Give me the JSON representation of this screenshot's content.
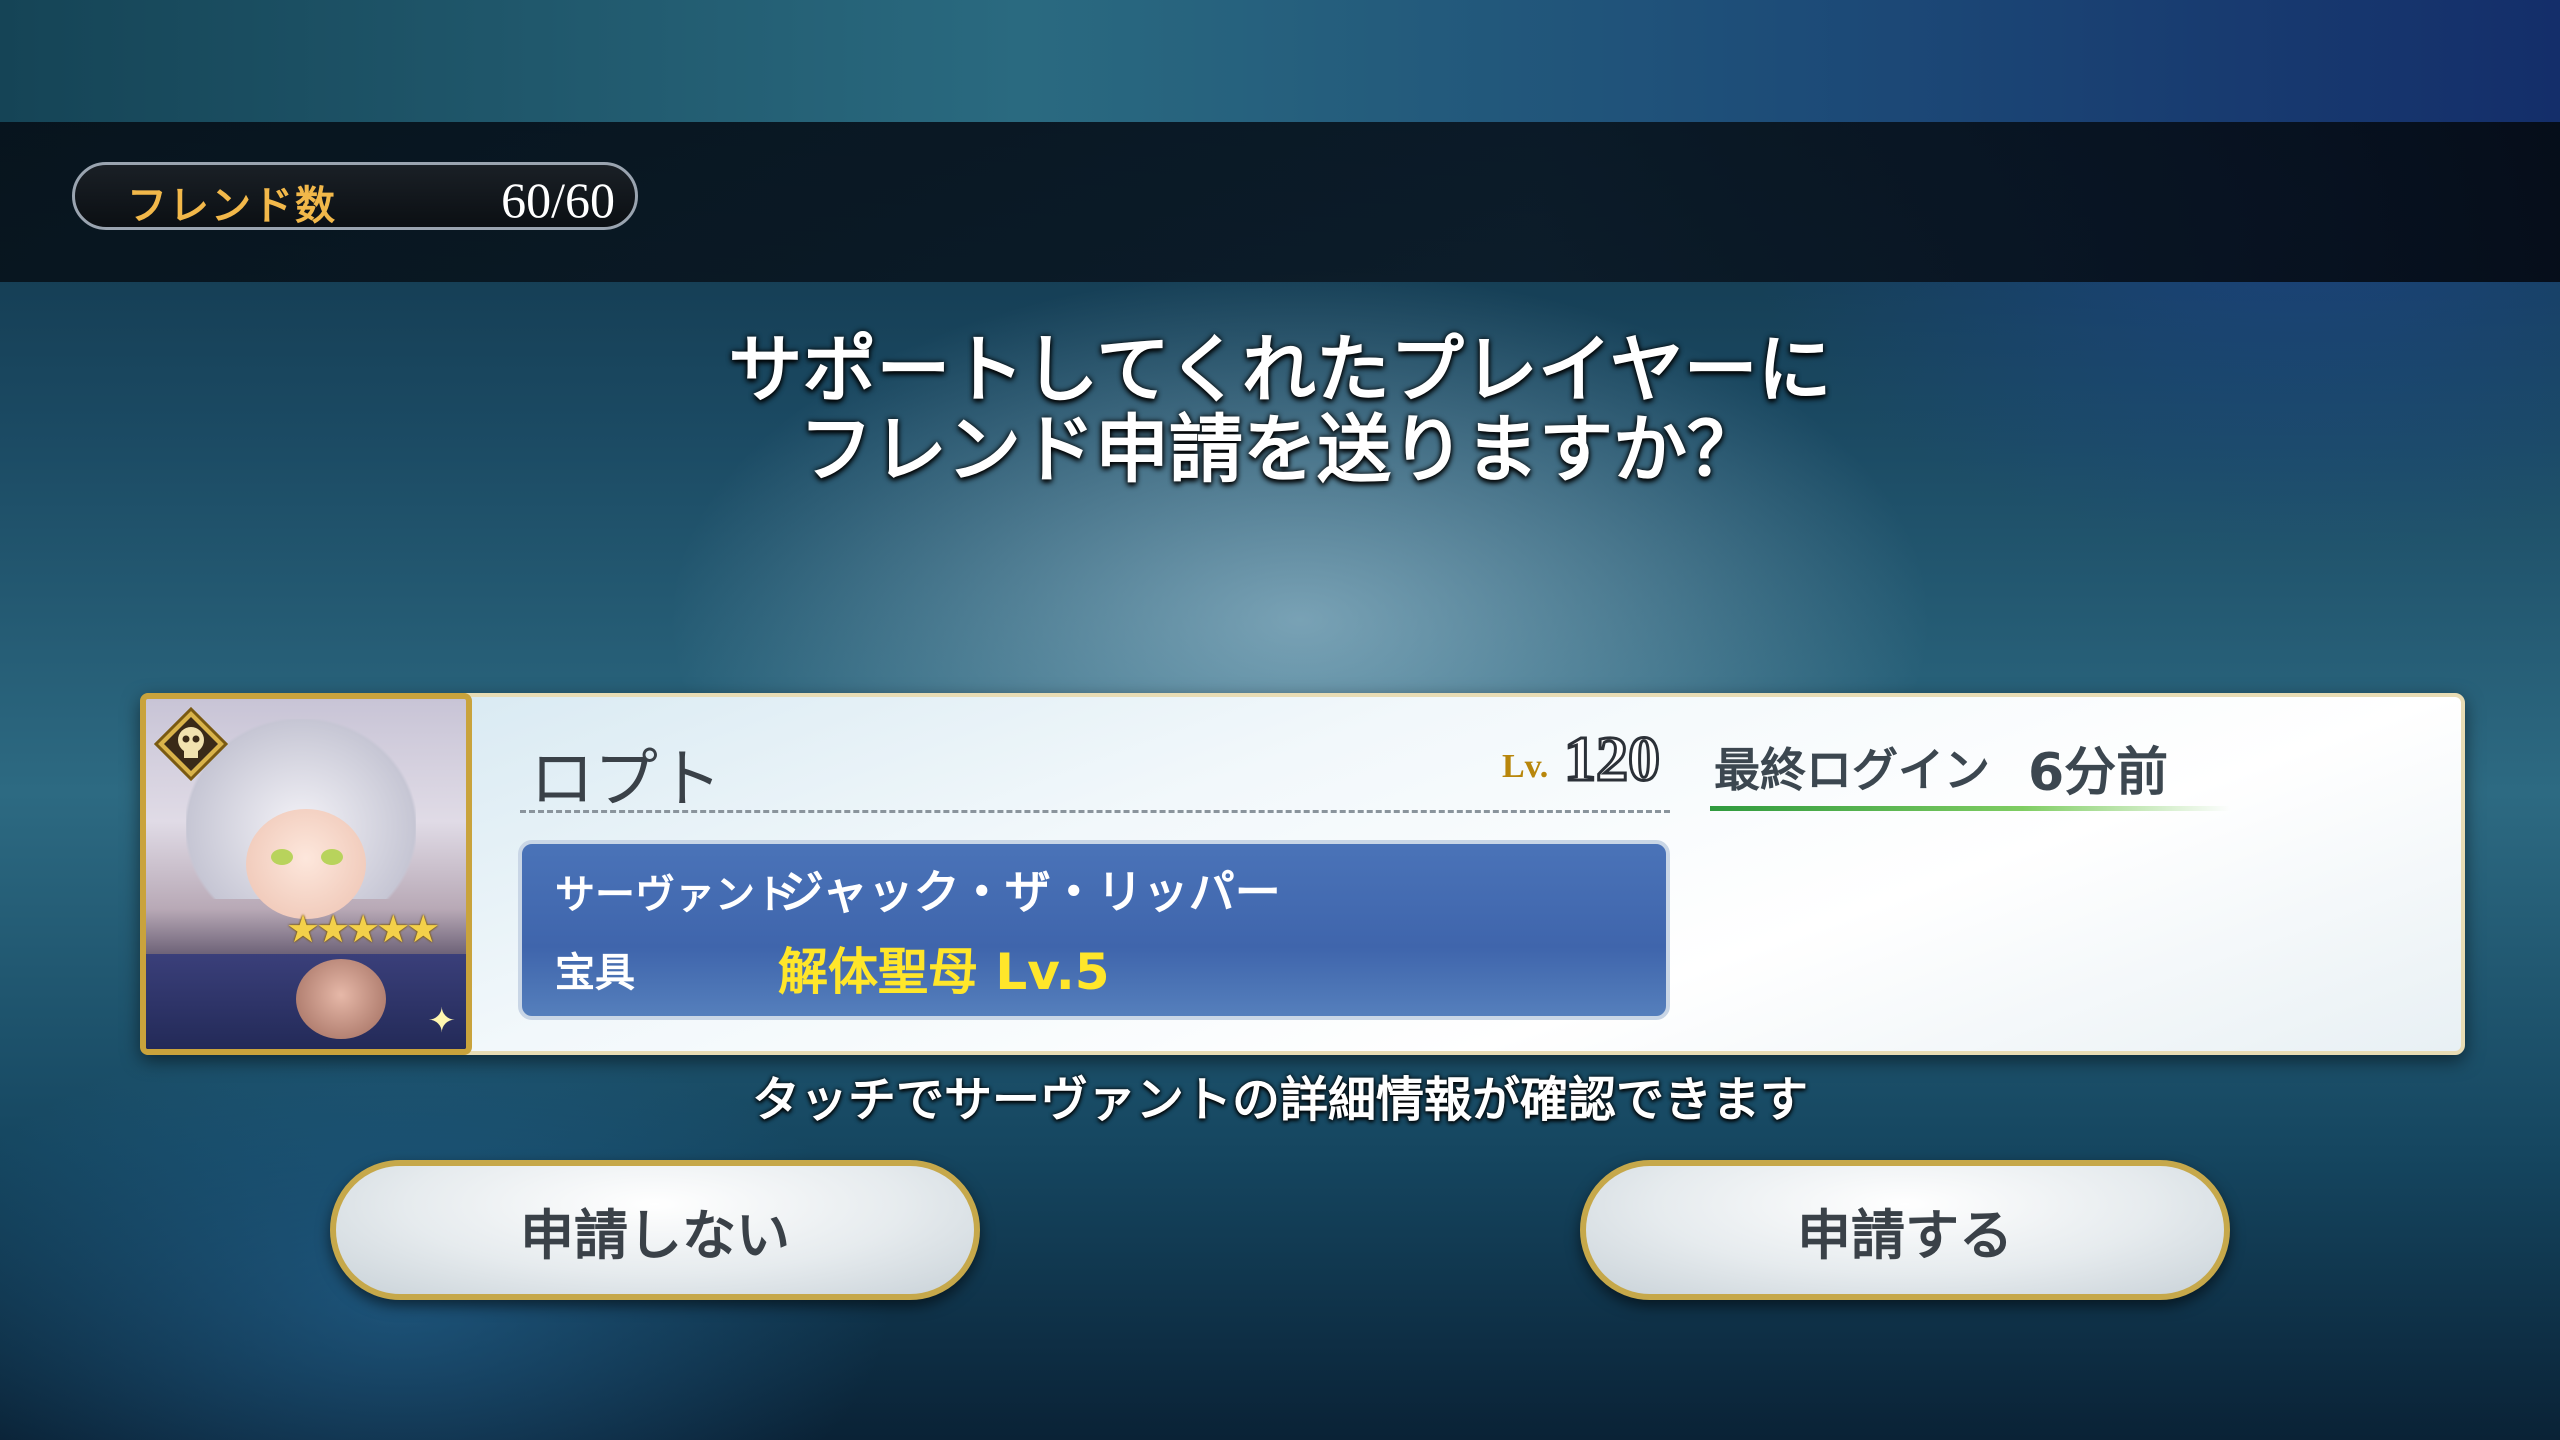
{
  "friends": {
    "label": "フレンド数",
    "count": "60/60"
  },
  "question": {
    "line1": "サポートしてくれたプレイヤーに",
    "line2": "フレンド申請を送りますか？"
  },
  "player": {
    "name": "ロプト",
    "level_tag": "Lv.",
    "level": "120",
    "last_login_label": "最終ログイン",
    "last_login_value": "6分前"
  },
  "servant": {
    "label": "サーヴァント",
    "name": "ジャック・ザ・リッパー",
    "np_label": "宝具",
    "np": "解体聖母 Lv.5",
    "rarity": "★★★★★",
    "class_icon": "assassin-class-icon"
  },
  "hint": "タッチでサーヴァントの詳細情報が確認できます",
  "buttons": {
    "decline": "申請しない",
    "accept": "申請する"
  },
  "colors": {
    "gold": "#c9a33c",
    "servant_bg": "#4a73b8",
    "np_yellow": "#ffe62a",
    "friend_label": "#f2b84a"
  }
}
